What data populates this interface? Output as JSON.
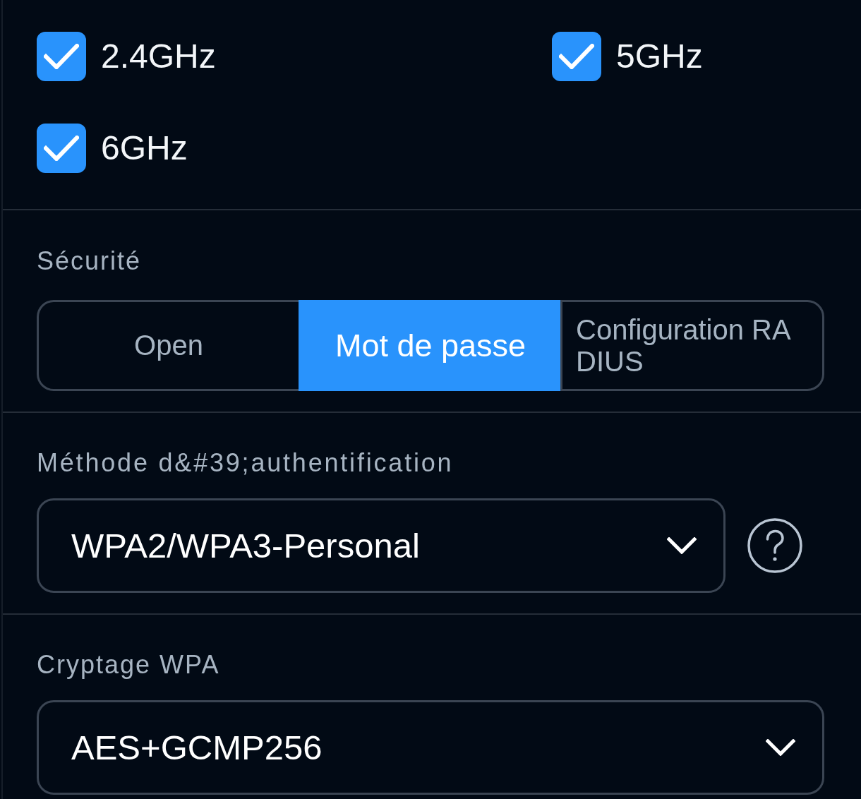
{
  "bands": [
    {
      "label": "2.4GHz",
      "checked": true
    },
    {
      "label": "5GHz",
      "checked": true
    },
    {
      "label": "6GHz",
      "checked": true
    }
  ],
  "security": {
    "label": "Sécurité",
    "options": [
      {
        "label": "Open",
        "selected": false
      },
      {
        "label": "Mot de passe",
        "selected": true
      },
      {
        "label": "Configuration RADIUS",
        "selected": false
      }
    ]
  },
  "auth_method": {
    "label": "Méthode d&#39;authentification",
    "value": "WPA2/WPA3-Personal"
  },
  "wpa_encryption": {
    "label": "Cryptage WPA",
    "value": "AES+GCMP256"
  }
}
